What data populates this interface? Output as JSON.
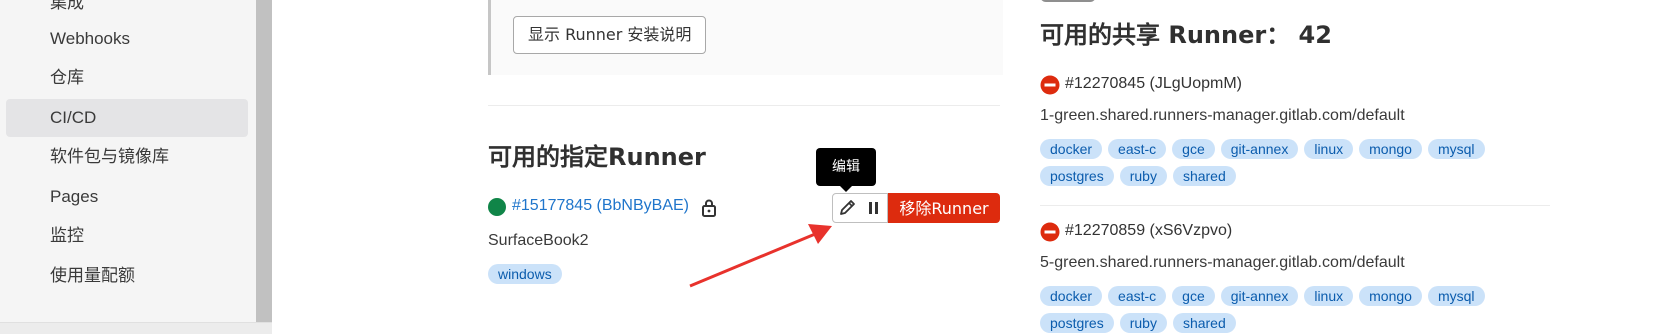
{
  "sidebar": {
    "items": [
      {
        "label": "集成"
      },
      {
        "label": "Webhooks"
      },
      {
        "label": "仓库"
      },
      {
        "label": "CI/CD"
      },
      {
        "label": "软件包与镜像库"
      },
      {
        "label": "Pages"
      },
      {
        "label": "监控"
      },
      {
        "label": "使用量配额"
      }
    ],
    "active": "CI/CD"
  },
  "install": {
    "button_label": "显示 Runner 安装说明"
  },
  "specific_runners": {
    "title": "可用的指定Runner",
    "runner": {
      "id_label": "#15177845 (BbNByBAE)",
      "description": "SurfaceBook2",
      "status_color": "#108548",
      "locked": true,
      "tags": [
        "windows"
      ]
    },
    "tooltip": "编辑",
    "remove_button": "移除Runner"
  },
  "shared_runners": {
    "title": "可用的共享 Runner：  42",
    "runners": [
      {
        "id_label": "#12270845 (JLgUopmM)",
        "description": "1-green.shared.runners-manager.gitlab.com/default",
        "tags": [
          "docker",
          "east-c",
          "gce",
          "git-annex",
          "linux",
          "mongo",
          "mysql",
          "postgres",
          "ruby",
          "shared"
        ]
      },
      {
        "id_label": "#12270859 (xS6Vzpvo)",
        "description": "5-green.shared.runners-manager.gitlab.com/default",
        "tags": [
          "docker",
          "east-c",
          "gce",
          "git-annex",
          "linux",
          "mongo",
          "mysql",
          "postgres",
          "ruby",
          "shared"
        ]
      }
    ]
  },
  "colors": {
    "link": "#1f75cb",
    "tag_bg": "#cbe2f9",
    "tag_text": "#0b5cad",
    "danger": "#dd2b0e",
    "annotation_arrow": "#e8322c"
  }
}
